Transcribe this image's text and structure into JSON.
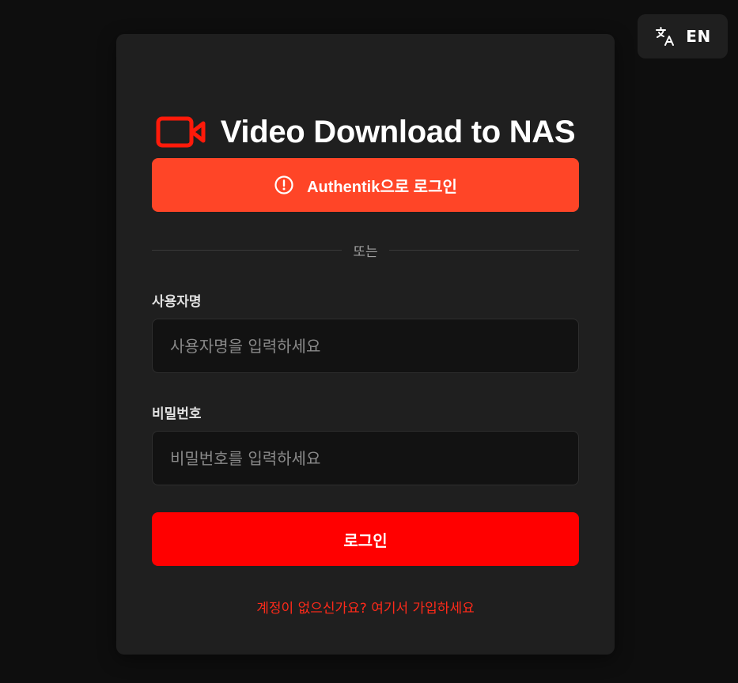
{
  "language_button": {
    "label": "EN",
    "icon": "translate-icon"
  },
  "card": {
    "title": "Video Download to NAS",
    "logo_icon": "video-camera-icon",
    "sso_button": {
      "label": "Authentik으로 로그인",
      "icon": "alert-circle-icon"
    },
    "divider_text": "또는",
    "username": {
      "label": "사용자명",
      "placeholder": "사용자명을 입력하세요",
      "value": ""
    },
    "password": {
      "label": "비밀번호",
      "placeholder": "비밀번호를 입력하세요",
      "value": ""
    },
    "login_button": {
      "label": "로그인"
    },
    "signup_link": "계정이 없으신가요? 여기서 가입하세요"
  },
  "colors": {
    "background": "#0e0e0e",
    "card": "#1f1f1f",
    "sso_accent": "#ff4527",
    "primary": "#ff0000",
    "link": "#ff2a1a"
  }
}
